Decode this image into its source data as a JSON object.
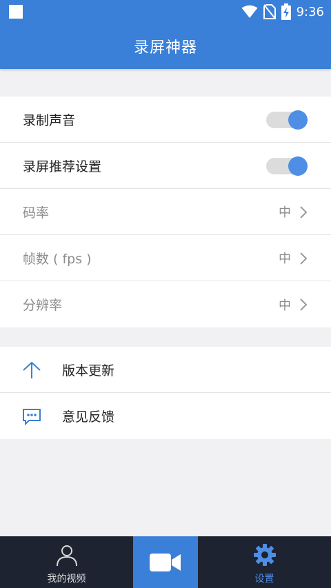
{
  "status_bar": {
    "time": "9:36",
    "icons": [
      "notification-square-icon",
      "wifi-icon",
      "no-sim-icon",
      "battery-charging-icon"
    ]
  },
  "app_bar": {
    "title": "录屏神器"
  },
  "settings": {
    "record_audio": {
      "label": "录制声音",
      "enabled": true
    },
    "recommended_settings": {
      "label": "录屏推荐设置",
      "enabled": true
    },
    "bitrate": {
      "label": "码率",
      "value": "中"
    },
    "fps": {
      "label": "帧数 ( fps )",
      "value": "中"
    },
    "resolution": {
      "label": "分辨率",
      "value": "中"
    }
  },
  "misc": {
    "update": {
      "label": "版本更新",
      "icon": "arrow-up-icon"
    },
    "feedback": {
      "label": "意见反馈",
      "icon": "chat-bubble-icon"
    }
  },
  "bottom_nav": {
    "items": [
      {
        "label": "我的视频",
        "icon": "person-icon",
        "active": false
      },
      {
        "label": "",
        "icon": "video-camera-icon",
        "active": false
      },
      {
        "label": "设置",
        "icon": "gear-icon",
        "active": true
      }
    ]
  },
  "colors": {
    "primary": "#3a7fd8",
    "toggle_on": "#4e8ee5",
    "nav_background": "#1d2330",
    "page_background": "#f1f1f3"
  }
}
